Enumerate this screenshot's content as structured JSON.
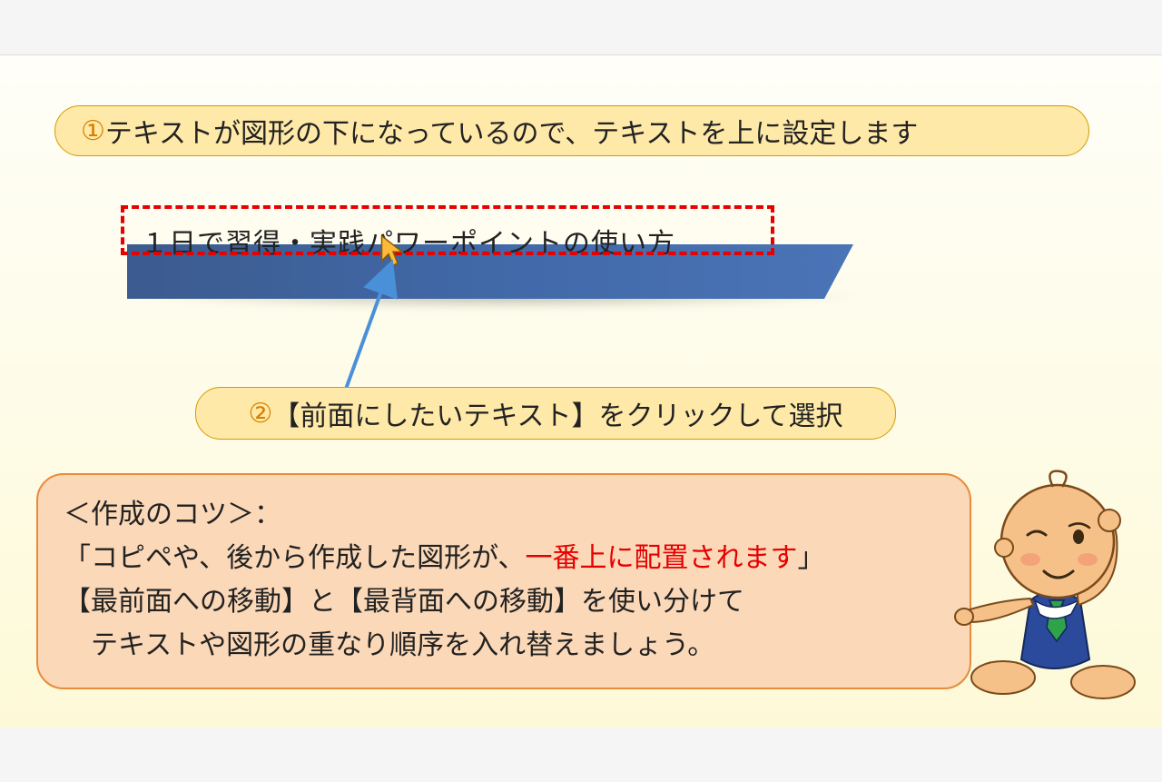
{
  "callout1": {
    "num": "①",
    "text": "テキストが図形の下になっているので、テキストを上に設定します"
  },
  "screenshot": {
    "banner_text": "１日で習得・実践パワーポイントの使い方"
  },
  "callout2": {
    "num": "②",
    "text": "【前面にしたいテキスト】をクリックして選択"
  },
  "tip": {
    "title": "＜作成のコツ＞：",
    "line2_a": "「コピペや、後から作成した図形が、",
    "line2_highlight": "一番上に配置されます",
    "line2_c": "」",
    "line3": "【最前面への移動】と【最背面への移動】を使い分けて",
    "line4": "　テキストや図形の重なり順序を入れ替えましょう。"
  }
}
